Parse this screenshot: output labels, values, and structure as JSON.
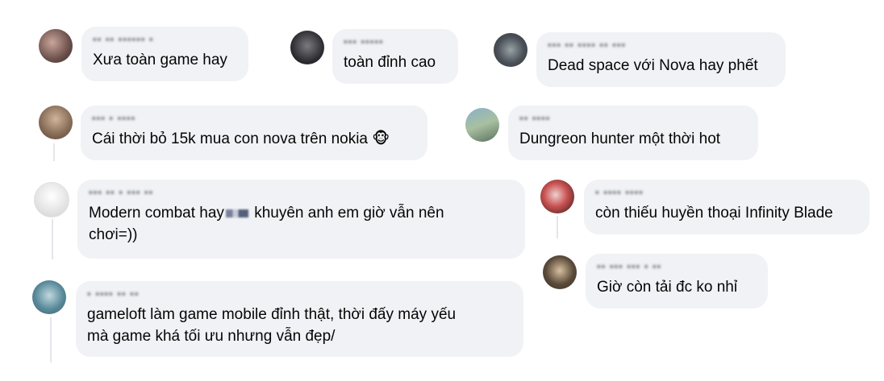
{
  "comments": [
    {
      "text": "Xưa toàn game hay",
      "avatar_colors": [
        "#6b4f4a",
        "#c9a59b",
        "#3a2c2e"
      ]
    },
    {
      "text": "toàn đỉnh cao",
      "avatar_colors": [
        "#2a2a2e",
        "#7a7a80",
        "#444"
      ]
    },
    {
      "text": "Dead space với Nova hay phết",
      "avatar_colors": [
        "#4a5158",
        "#9aa3a8",
        "#2f3438"
      ]
    },
    {
      "text": "Cái thời bỏ 15k mua con nova trên nokia",
      "emoji": "🐵",
      "avatar_colors": [
        "#8a6f5a",
        "#d2b59a",
        "#5a4030"
      ]
    },
    {
      "text": "Dungreon hunter một thời hot",
      "avatar_colors": [
        "#6b8aa0",
        "#a8c0a0",
        "#5a7060"
      ]
    },
    {
      "text_before": "Modern combat hay",
      "text_after": " khuyên anh em giờ vẫn nên\nchơi=))",
      "avatar_colors": [
        "#e8e8e8",
        "#f5f5f5",
        "#d8d8d8"
      ]
    },
    {
      "text": "còn thiếu huyền thoại Infinity Blade",
      "avatar_colors": [
        "#7a2a2a",
        "#c85050",
        "#2a1a1a"
      ]
    },
    {
      "text": "Giờ còn tải đc ko nhỉ",
      "avatar_colors": [
        "#5a4a3a",
        "#a89070",
        "#3a2e24"
      ]
    },
    {
      "text": "gameloft làm game mobile đỉnh thật, thời đấy máy yếu\nmà game khá tối ưu nhưng vẫn đẹp/",
      "avatar_colors": [
        "#5a8a9a",
        "#9ac0c8",
        "#3a6070"
      ]
    }
  ]
}
